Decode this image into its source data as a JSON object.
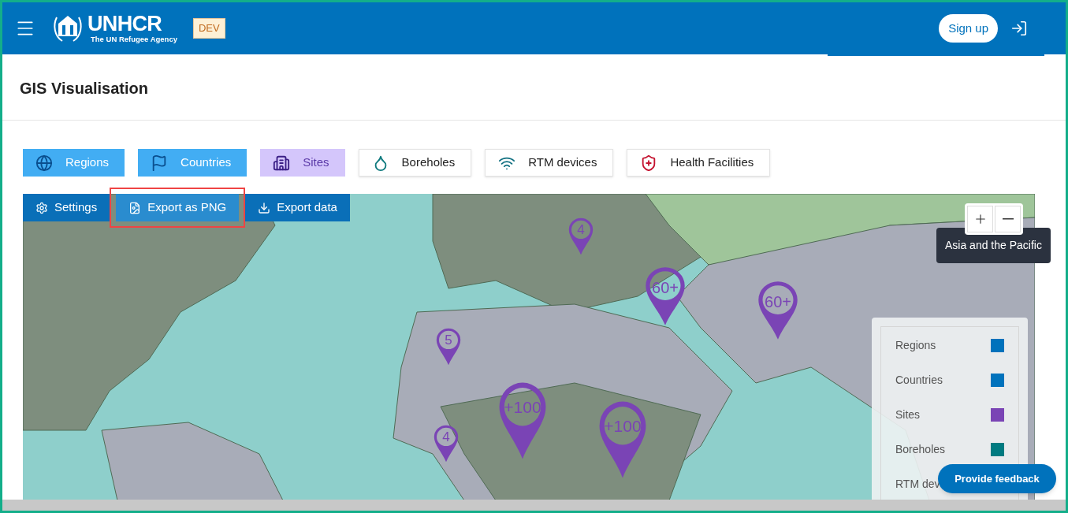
{
  "header": {
    "logo_title": "UNHCR",
    "logo_subtitle": "The UN Refugee Agency",
    "env_badge": "DEV",
    "sign_up": "Sign up"
  },
  "page_title": "GIS Visualisation",
  "layers": [
    {
      "label": "Regions",
      "kind": "globe",
      "on": true,
      "color": "#42adf3"
    },
    {
      "label": "Countries",
      "kind": "flag",
      "on": true,
      "color": "#42adf3"
    },
    {
      "label": "Sites",
      "kind": "building",
      "on": true,
      "color": "#d4c6fb"
    },
    {
      "label": "Boreholes",
      "kind": "drop",
      "on": false
    },
    {
      "label": "RTM devices",
      "kind": "signal",
      "on": false
    },
    {
      "label": "Health Facilities",
      "kind": "shield",
      "on": false
    }
  ],
  "map_toolbar": [
    {
      "label": "Settings",
      "kind": "settings",
      "highlighted": false
    },
    {
      "label": "Export as PNG",
      "kind": "image",
      "highlighted": true
    },
    {
      "label": "Export data",
      "kind": "download",
      "highlighted": false
    }
  ],
  "markers": [
    {
      "count": "4",
      "kind": "small"
    },
    {
      "count": "60+",
      "kind": "medium"
    },
    {
      "count": "60+",
      "kind": "medium"
    },
    {
      "count": "5",
      "kind": "small"
    },
    {
      "count": "+100",
      "kind": "large"
    },
    {
      "count": "+100",
      "kind": "large"
    },
    {
      "count": "4",
      "kind": "small"
    }
  ],
  "tooltip": "Asia and the Pacific",
  "legend": [
    {
      "label": "Regions",
      "color": "#0072bc"
    },
    {
      "label": "Countries",
      "color": "#0072bc"
    },
    {
      "label": "Sites",
      "color": "#7a44b5"
    },
    {
      "label": "Boreholes",
      "color": "#007a80"
    },
    {
      "label": "RTM dev"
    }
  ],
  "feedback_button": "Provide feedback"
}
